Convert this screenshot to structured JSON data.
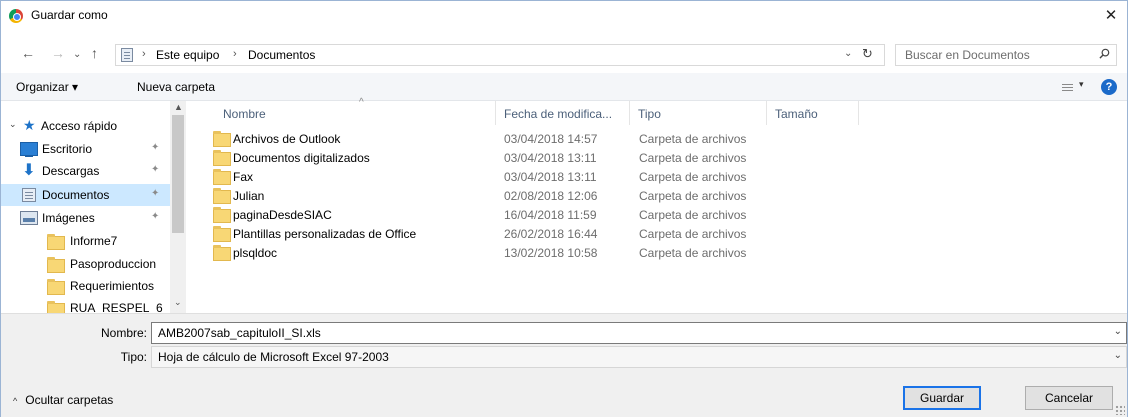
{
  "window": {
    "title": "Guardar como",
    "close_glyph": "✕"
  },
  "nav": {
    "back_glyph": "←",
    "forward_glyph": "→",
    "recent_glyph": "⌄",
    "up_glyph": "↑",
    "breadcrumb": [
      "Este equipo",
      "Documentos"
    ],
    "separator": "›",
    "dropdown_glyph": "⌄",
    "refresh_glyph": "↻"
  },
  "search": {
    "placeholder": "Buscar en Documentos"
  },
  "toolbar": {
    "organize_label": "Organizar ▾",
    "new_folder_label": "Nueva carpeta",
    "view_caret": "▾",
    "help": "?"
  },
  "sidebar": {
    "quick_access": "Acceso rápido",
    "items": [
      {
        "label": "Escritorio",
        "icon": "desktop-icon",
        "pinned": true
      },
      {
        "label": "Descargas",
        "icon": "download-icon",
        "pinned": true
      },
      {
        "label": "Documentos",
        "icon": "documents-icon",
        "pinned": true,
        "selected": true
      },
      {
        "label": "Imágenes",
        "icon": "images-icon",
        "pinned": true
      },
      {
        "label": "Informe7",
        "icon": "folder-icon"
      },
      {
        "label": "Pasoproduccion",
        "icon": "folder-icon"
      },
      {
        "label": "Requerimientos",
        "icon": "folder-icon"
      },
      {
        "label": "RUA_RESPEL_6",
        "icon": "folder-icon"
      }
    ],
    "pin_glyph": "📌",
    "scroll_up": "▲",
    "scroll_down": "⌄"
  },
  "filelist": {
    "columns": [
      "Nombre",
      "Fecha de modifica...",
      "Tipo",
      "Tamaño"
    ],
    "sort_glyph": "^",
    "rows": [
      {
        "name": "Archivos de Outlook",
        "date": "03/04/2018 14:57",
        "type": "Carpeta de archivos"
      },
      {
        "name": "Documentos digitalizados",
        "date": "03/04/2018 13:11",
        "type": "Carpeta de archivos"
      },
      {
        "name": "Fax",
        "date": "03/04/2018 13:11",
        "type": "Carpeta de archivos"
      },
      {
        "name": "Julian",
        "date": "02/08/2018 12:06",
        "type": "Carpeta de archivos"
      },
      {
        "name": "paginaDesdeSIAC",
        "date": "16/04/2018 11:59",
        "type": "Carpeta de archivos"
      },
      {
        "name": "Plantillas personalizadas de Office",
        "date": "26/02/2018 16:44",
        "type": "Carpeta de archivos"
      },
      {
        "name": "plsqldoc",
        "date": "13/02/2018 10:58",
        "type": "Carpeta de archivos"
      }
    ]
  },
  "form": {
    "name_label": "Nombre:",
    "name_value": "AMB2007sab_capituloII_SI.xls",
    "type_label": "Tipo:",
    "type_value": "Hoja de cálculo de Microsoft Excel 97-2003",
    "dropdown_glyph": "⌄"
  },
  "footer": {
    "hide_folders": "Ocultar carpetas",
    "hide_chevron": "^",
    "save": "Guardar",
    "cancel": "Cancelar"
  }
}
